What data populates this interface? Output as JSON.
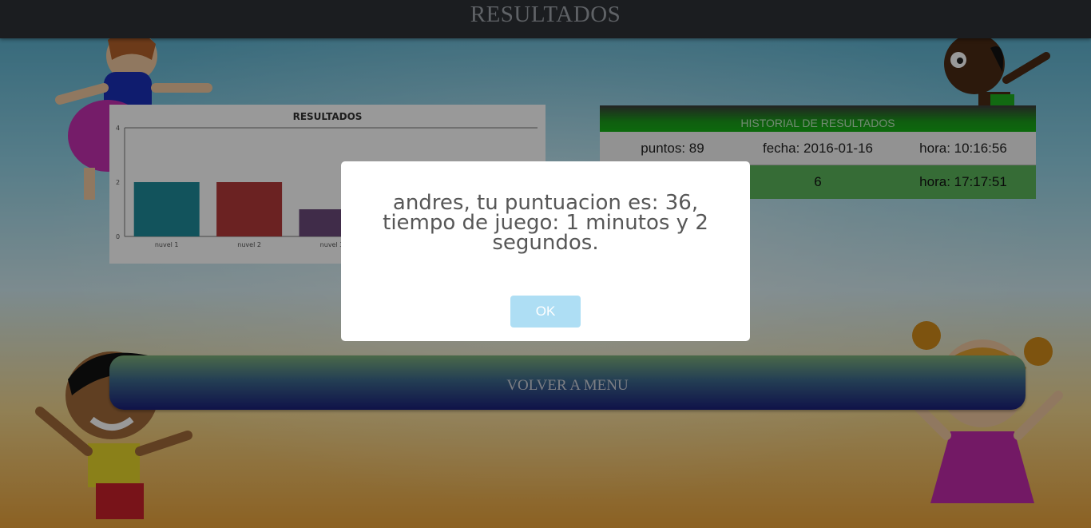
{
  "header": {
    "title": "RESULTADOS"
  },
  "chart_data": {
    "type": "bar",
    "title": "RESULTADOS",
    "categories": [
      "nuvel 1",
      "nuvel 2",
      "nuvel 3"
    ],
    "values": [
      2,
      2,
      1
    ],
    "colors": [
      "#1f8a9a",
      "#b23a3a",
      "#6b4a7a"
    ],
    "ylim": [
      0,
      4
    ],
    "yticks": [
      "0",
      "2",
      "4"
    ],
    "grid": false
  },
  "history": {
    "header": "HISTORIAL DE RESULTADOS",
    "rows": [
      {
        "puntos": "puntos: 89",
        "fecha": "fecha: 2016-01-16",
        "hora": "hora: 10:16:56"
      },
      {
        "puntos": "",
        "fecha": "6",
        "hora": "hora: 17:17:51"
      }
    ]
  },
  "menu_button": {
    "label": "VOLVER A MENU"
  },
  "modal": {
    "message": "andres, tu puntuacion es: 36, tiempo de juego: 1 minutos y 2 segundos.",
    "ok_label": "OK"
  },
  "colors": {
    "topbar": "#2e3136",
    "history_header": "#16b016",
    "history_row_alt": "#5bb55b",
    "ok_button": "#aedef4"
  }
}
